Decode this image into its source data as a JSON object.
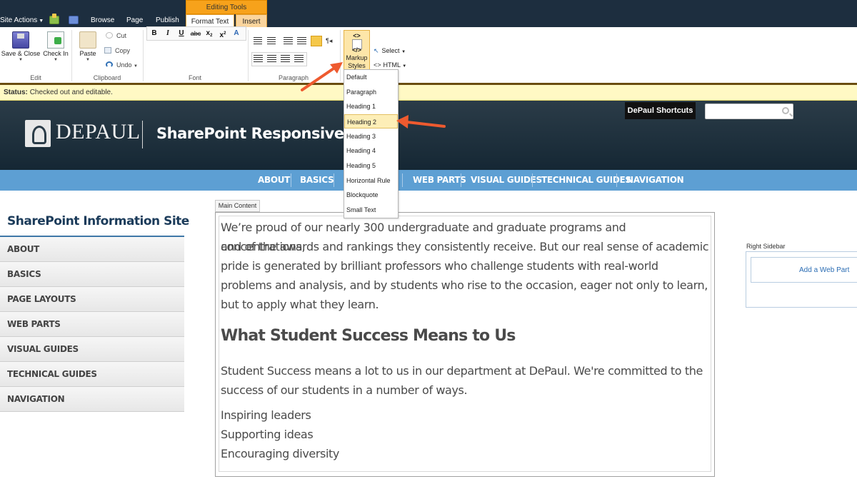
{
  "suite": {
    "site_actions": "Site Actions",
    "tabs": {
      "browse": "Browse",
      "page": "Page",
      "publish": "Publish"
    },
    "contextual": {
      "group": "Editing Tools",
      "format_text": "Format Text",
      "insert": "Insert"
    }
  },
  "ribbon": {
    "edit": {
      "save_close": "Save & Close",
      "check_in": "Check In",
      "label": "Edit"
    },
    "clipboard": {
      "paste": "Paste",
      "cut": "Cut",
      "copy": "Copy",
      "undo": "Undo",
      "label": "Clipboard"
    },
    "font": {
      "label": "Font",
      "bold": "B",
      "italic": "I",
      "underline": "U",
      "strike": "abc",
      "sub": "x",
      "sup": "x"
    },
    "paragraph": {
      "label": "Paragraph"
    },
    "markup": {
      "tag": "<>",
      "tag2": "</>",
      "label_line1": "Markup",
      "label_line2": "Styles"
    },
    "select": "Select",
    "html": "HTML"
  },
  "markup_menu": {
    "items": [
      "Default",
      "Paragraph",
      "Heading 1",
      "Heading 2",
      "Heading 3",
      "Heading 4",
      "Heading 5",
      "Horizontal Rule",
      "Blockquote",
      "Small Text"
    ],
    "highlighted": "Heading 2"
  },
  "status": {
    "label": "Status:",
    "text": "Checked out and editable."
  },
  "header": {
    "logo_text": "DEPAUL",
    "site_title": "SharePoint Responsive",
    "shortcuts": "DePaul Shortcuts",
    "search_placeholder": ""
  },
  "topnav": [
    "ABOUT",
    "BASICS",
    "WEB PARTS",
    "VISUAL GUIDES",
    "TECHNICAL GUIDES",
    "NAVIGATION"
  ],
  "leftnav": {
    "title": "SharePoint Information Site",
    "items": [
      "ABOUT",
      "BASICS",
      "PAGE LAYOUTS",
      "WEB PARTS",
      "VISUAL GUIDES",
      "TECHNICAL GUIDES",
      "NAVIGATION"
    ]
  },
  "main": {
    "label": "Main Content",
    "intro_lines": [
      "We’re proud of our nearly 300 undergraduate and graduate programs and concentrations,",
      "and of the awards and rankings they consistently receive. But our real sense of academic",
      "pride is generated by brilliant professors who challenge students with real-world",
      "problems and analysis, and by students who rise to the occasion, eager not only to learn,",
      "but to apply what they learn."
    ],
    "heading": "What Student Success Means to Us",
    "para_lines": [
      "Student Success means a lot to us in our department at DePaul. We're committed to the",
      "success of our students in a number of ways."
    ],
    "list": [
      "Inspiring leaders",
      "Supporting ideas",
      "Encouraging diversity"
    ]
  },
  "sidebar": {
    "label": "Right Sidebar",
    "add_web_part": "Add a Web Part"
  },
  "colors": {
    "suitebar": "#1d2e3f",
    "editing_tools": "#f7a21b",
    "nav_blue": "#5d9fd3",
    "status_yellow": "#fff9c4",
    "arrow": "#ee5a2f"
  }
}
